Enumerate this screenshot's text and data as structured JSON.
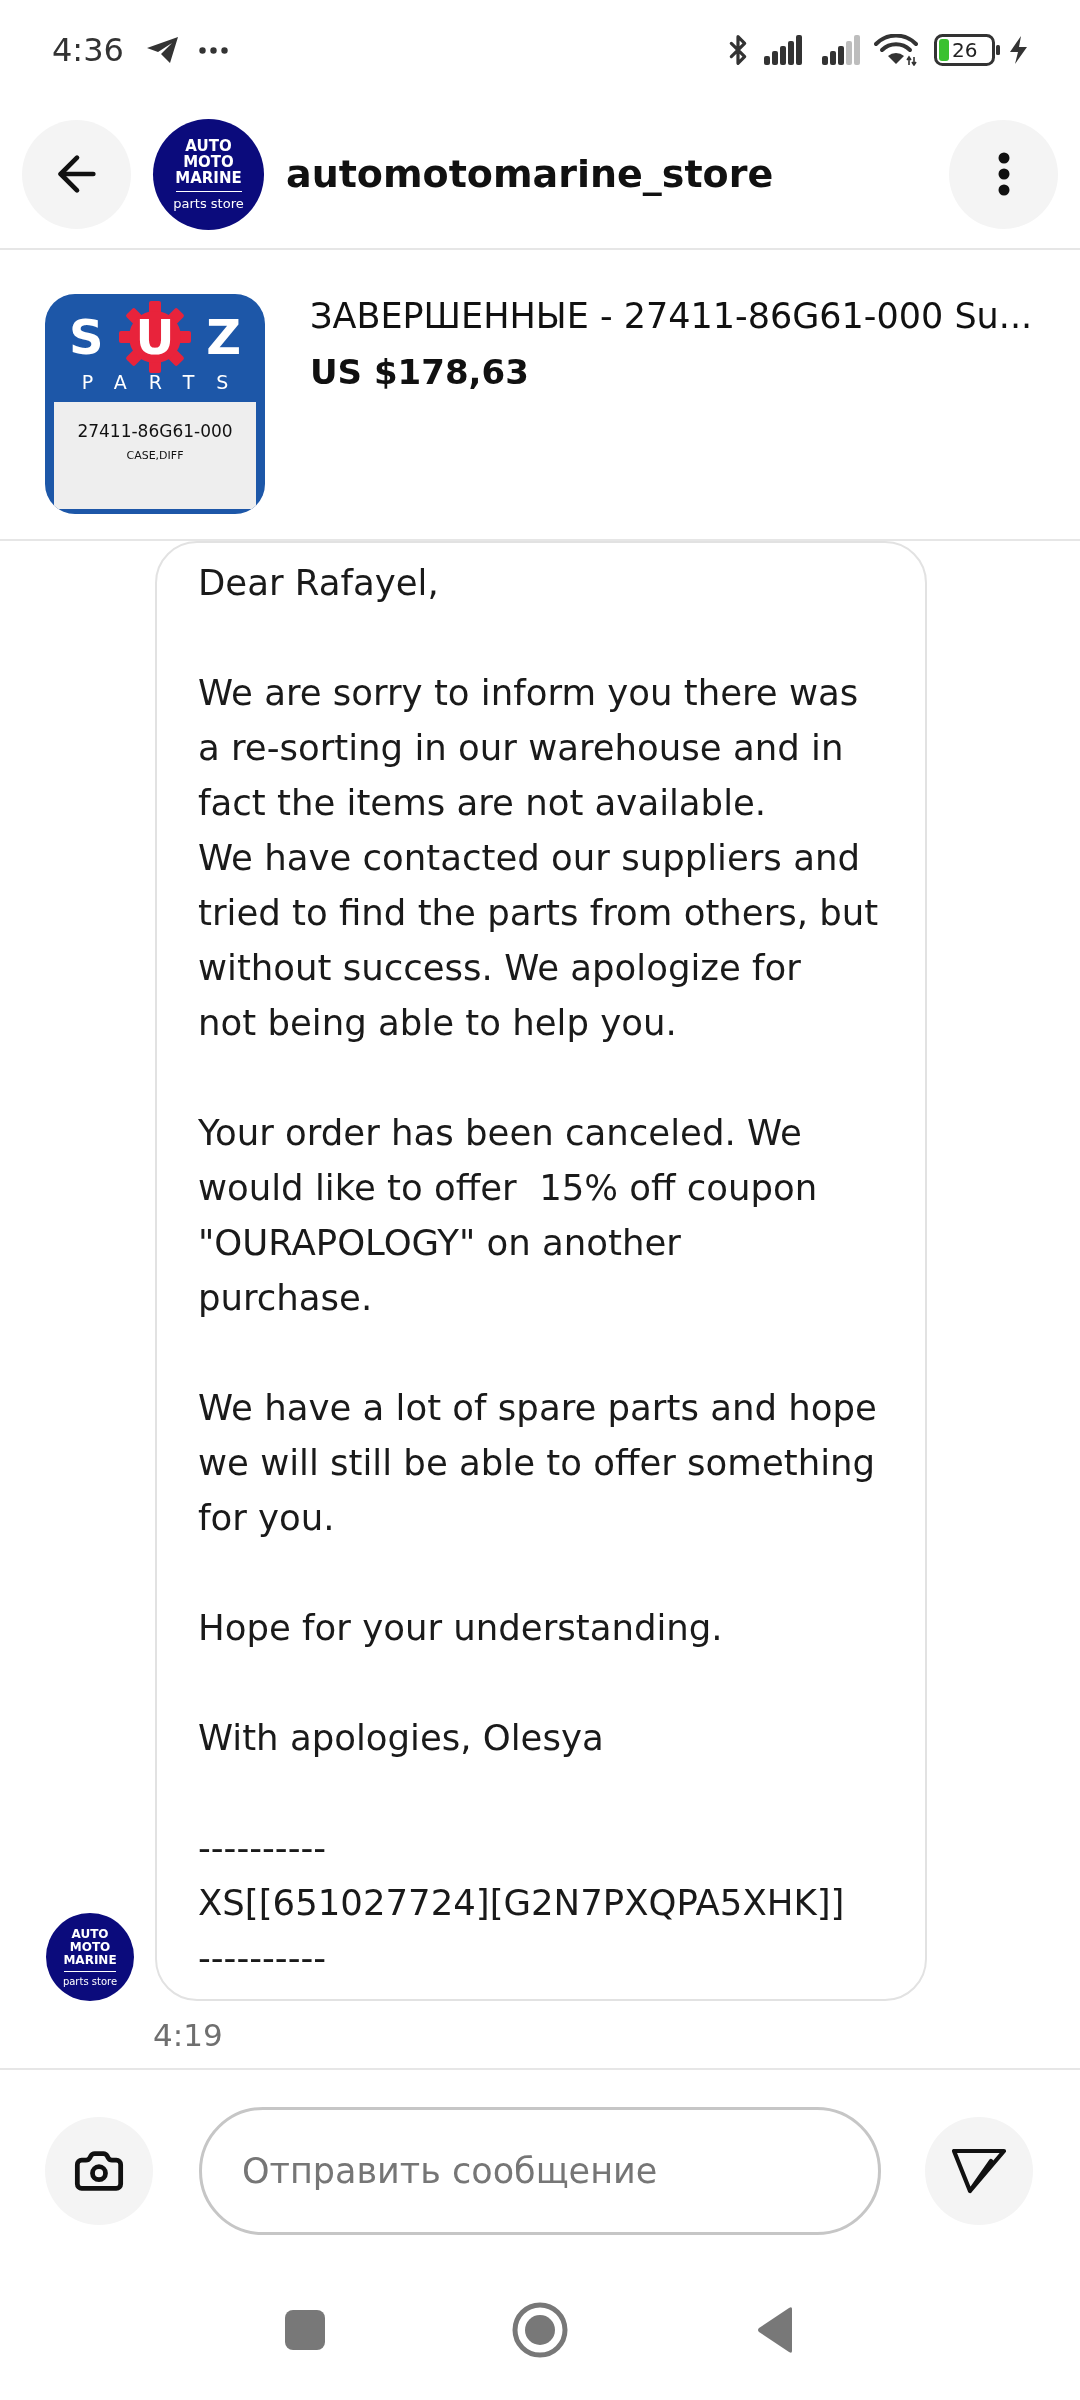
{
  "status_bar": {
    "time": "4:36",
    "battery_percent": "26"
  },
  "header": {
    "title": "automotomarine_store",
    "logo": {
      "lines": [
        "AUTO",
        "MOTO",
        "MARINE"
      ],
      "tagline": "parts store"
    }
  },
  "item": {
    "title": "ЗАВЕРШЕННЫЕ - 27411-86G61-000 Su...",
    "price": "US $178,63",
    "thumbnail": {
      "letters": [
        "S",
        "U",
        "Z"
      ],
      "brand_line": "PARTS",
      "part_number": "27411-86G61-000",
      "part_name": "CASE,DIFF"
    }
  },
  "messages": [
    {
      "sender_logo": {
        "lines": [
          "AUTO",
          "MOTO",
          "MARINE"
        ],
        "tagline": "parts store"
      },
      "paragraphs": [
        "Dear Rafayel,",
        "We are sorry to inform you there was\na re-sorting in our warehouse and in\nfact the items are not available.\nWe have contacted our suppliers and\ntried to find the parts from others, but\nwithout success. We apologize for\nnot being able to help you.",
        "Your order has been canceled. We\nwould like to offer  15% off coupon\n\"OURAPOLOGY\" on another\npurchase.",
        "We have a lot of spare parts and hope\nwe will still be able to offer something\nfor you.",
        "Hope for your understanding.",
        "With apologies, Olesya",
        "----------\nXS[[651027724][G2N7PXQPA5XHK]]\n----------"
      ],
      "time": "4:19"
    }
  ],
  "composer": {
    "placeholder": "Отправить сообщение"
  }
}
